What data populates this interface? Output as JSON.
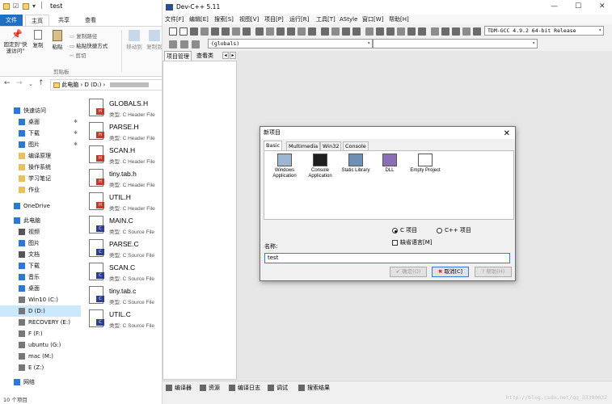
{
  "explorer": {
    "title": "test",
    "ribbon_tabs": [
      "文件",
      "主页",
      "共享",
      "查看"
    ],
    "ribbon": {
      "pin_label": "固定到\"快速访问\"",
      "copy_label": "复制",
      "paste_label": "粘贴",
      "copy_path": "复制路径",
      "paste_shortcut": "粘贴快捷方式",
      "cut": "剪切",
      "clipboard_group": "剪贴板",
      "move_to": "移动到",
      "copy_to": "复制到"
    },
    "address": "此电脑 › D (D:) ›",
    "nav_tree": [
      {
        "label": "快速访问",
        "icon": "star-icon"
      },
      {
        "label": "桌面",
        "icon": "desktop-icon",
        "pinned": true
      },
      {
        "label": "下载",
        "icon": "download-icon",
        "pinned": true
      },
      {
        "label": "图片",
        "icon": "pictures-icon",
        "pinned": true
      },
      {
        "label": "编译原理",
        "icon": "folder-icon"
      },
      {
        "label": "操作系统",
        "icon": "folder-icon"
      },
      {
        "label": "学习笔记",
        "icon": "folder-icon"
      },
      {
        "label": "作业",
        "icon": "folder-icon"
      },
      {
        "label": "OneDrive",
        "icon": "cloud-icon"
      },
      {
        "label": "此电脑",
        "icon": "computer-icon"
      },
      {
        "label": "视频",
        "icon": "video-icon"
      },
      {
        "label": "图片",
        "icon": "pictures-icon"
      },
      {
        "label": "文档",
        "icon": "documents-icon"
      },
      {
        "label": "下载",
        "icon": "download-icon"
      },
      {
        "label": "音乐",
        "icon": "music-icon"
      },
      {
        "label": "桌面",
        "icon": "desktop-icon"
      },
      {
        "label": "Win10 (C:)",
        "icon": "drive-icon"
      },
      {
        "label": "D (D:)",
        "icon": "drive-icon",
        "selected": true
      },
      {
        "label": "RECOVERY (E:)",
        "icon": "drive-icon"
      },
      {
        "label": "F (F:)",
        "icon": "drive-icon"
      },
      {
        "label": "ubuntu (G:)",
        "icon": "drive-icon"
      },
      {
        "label": "mac (M:)",
        "icon": "drive-icon"
      },
      {
        "label": "E (Z:)",
        "icon": "drive-icon"
      },
      {
        "label": "网络",
        "icon": "network-icon"
      }
    ],
    "files": [
      {
        "name": "GLOBALS.H",
        "type": "类型: C Header File",
        "tag": "H"
      },
      {
        "name": "PARSE.H",
        "type": "类型: C Header File",
        "tag": "H"
      },
      {
        "name": "SCAN.H",
        "type": "类型: C Header File",
        "tag": "H"
      },
      {
        "name": "tiny.tab.h",
        "type": "类型: C Header File",
        "tag": "H"
      },
      {
        "name": "UTIL.H",
        "type": "类型: C Header File",
        "tag": "H"
      },
      {
        "name": "MAIN.C",
        "type": "类型: C Source File",
        "tag": "C"
      },
      {
        "name": "PARSE.C",
        "type": "类型: C Source File",
        "tag": "C"
      },
      {
        "name": "SCAN.C",
        "type": "类型: C Source File",
        "tag": "C"
      },
      {
        "name": "tiny.tab.c",
        "type": "类型: C Source File",
        "tag": "C"
      },
      {
        "name": "UTIL.C",
        "type": "类型: C Source File",
        "tag": "C"
      }
    ],
    "status": "10 个项目"
  },
  "devcpp": {
    "title": "Dev-C++ 5.11",
    "menu": [
      "文件[F]",
      "编辑[E]",
      "搜索[S]",
      "视图[V]",
      "项目[P]",
      "运行[R]",
      "工具[T]",
      "AStyle",
      "窗口[W]",
      "帮助[H]"
    ],
    "compiler": "TDM-GCC 4.9.2 64-bit Release",
    "scope": "(globals)",
    "project_tabs": [
      "项目管理",
      "查看类"
    ],
    "bottom_tabs": [
      "编译器",
      "资源",
      "编译日志",
      "调试",
      "搜索结果"
    ],
    "watermark": "http://blog.csdn.net/qq_33390032"
  },
  "dialog": {
    "title": "新项目",
    "tabs": [
      "Basic",
      "Multimedia",
      "Win32",
      "Console"
    ],
    "templates": [
      {
        "label": "Windows Application",
        "icon": "window-app-icon"
      },
      {
        "label": "Console Application",
        "icon": "console-app-icon"
      },
      {
        "label": "Static Library",
        "icon": "static-lib-icon"
      },
      {
        "label": "DLL",
        "icon": "dll-icon"
      },
      {
        "label": "Empty Project",
        "icon": "empty-project-icon"
      }
    ],
    "lang_c": "C 项目",
    "lang_cpp": "C++ 项目",
    "default_lang": "缺省语言[M]",
    "name_label": "名称:",
    "name_value": "test",
    "ok": "确定(O)",
    "cancel": "取消[C]",
    "help": "帮助(H)"
  }
}
